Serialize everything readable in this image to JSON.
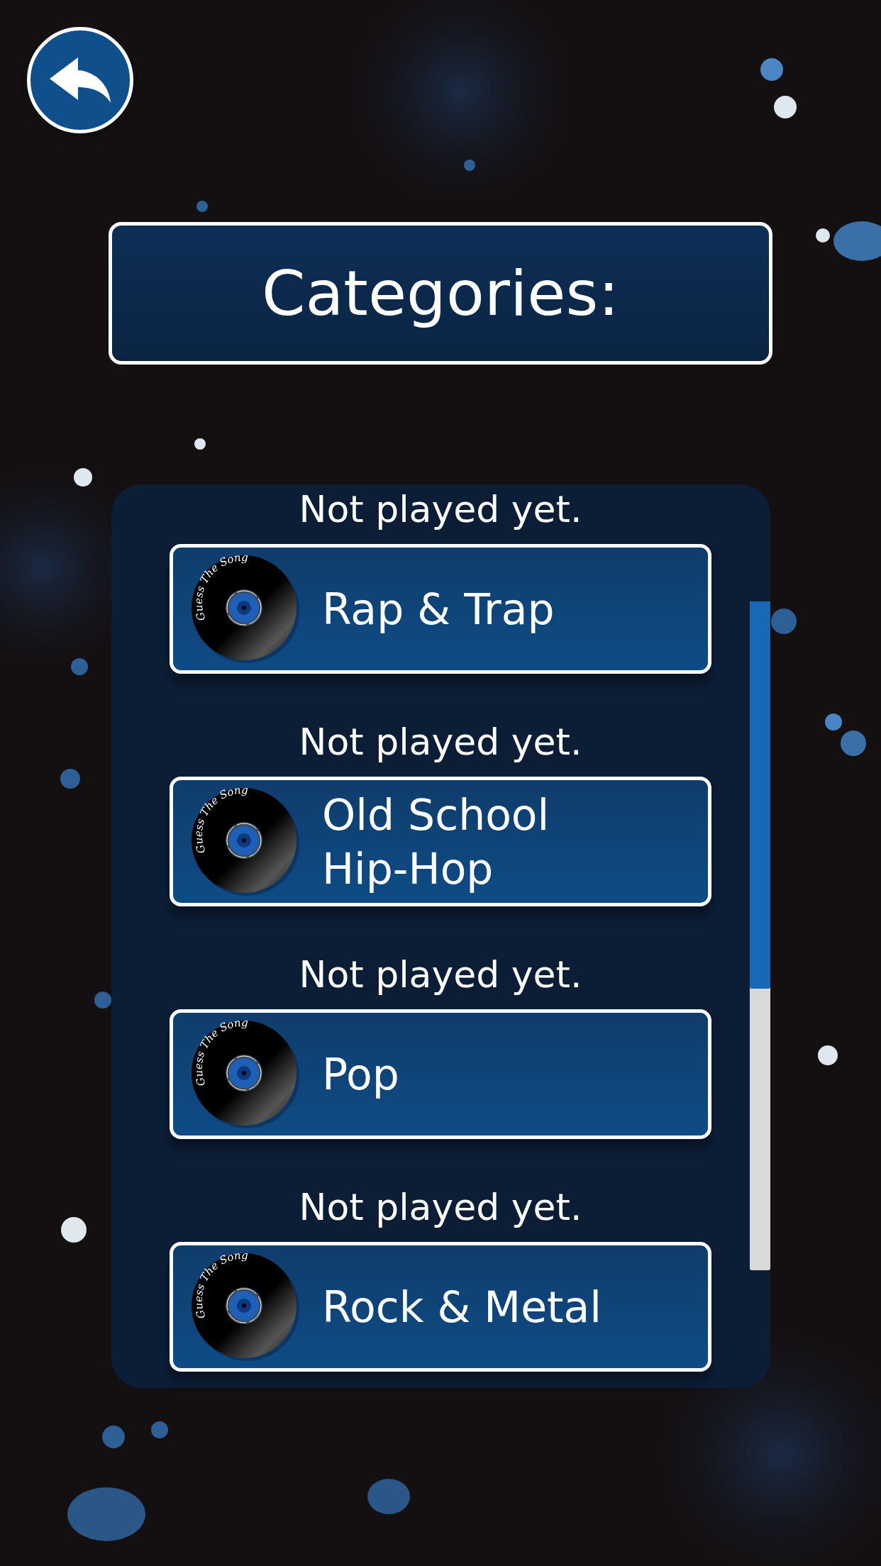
{
  "title": "Categories:",
  "categories": [
    {
      "status": "Not played yet.",
      "name": "Rap & Trap",
      "logo_text": "Guess The Song"
    },
    {
      "status": "Not played yet.",
      "name": "Old School\nHip-Hop",
      "logo_text": "Guess The Song"
    },
    {
      "status": "Not played yet.",
      "name": "Pop",
      "logo_text": "Guess The Song"
    },
    {
      "status": "Not played yet.",
      "name": "Rock & Metal",
      "logo_text": "Guess The Song"
    }
  ]
}
